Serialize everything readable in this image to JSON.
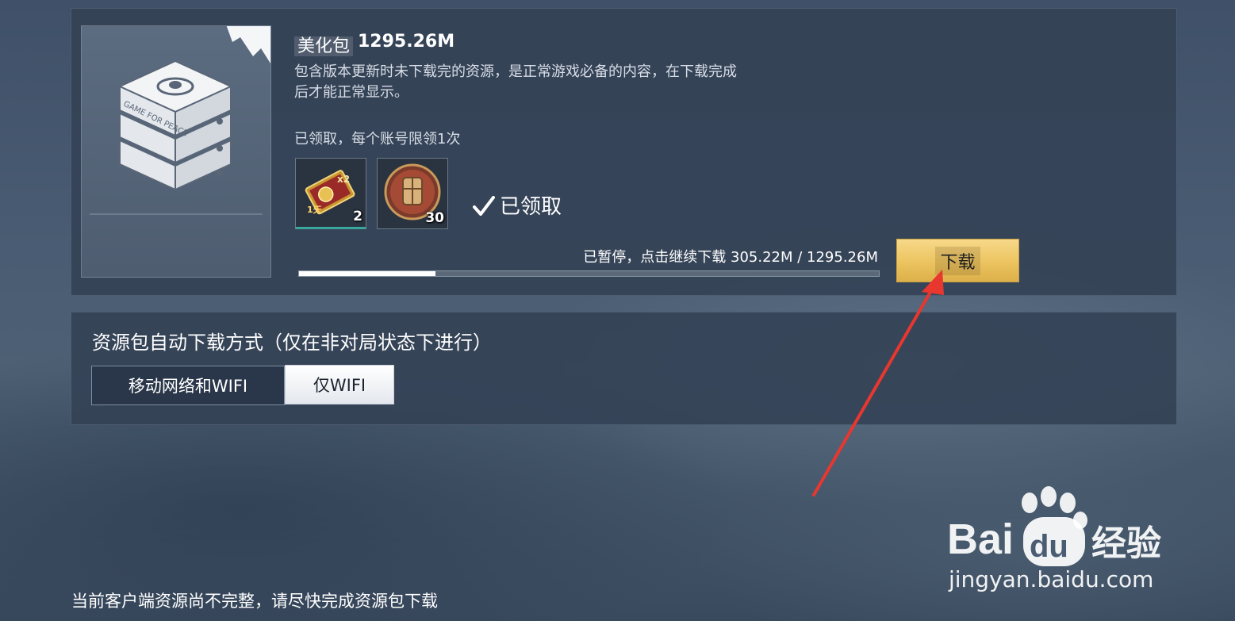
{
  "pack": {
    "name": "美化包",
    "size": "1295.26M",
    "description_line1": "包含版本更新时未下载完的资源，是正常游戏必备的内容，在下载完成",
    "description_line2": "后才能正常显示。",
    "claim_note": "已领取，每个账号限领1次",
    "thumb_label": "GAME FOR PEACE",
    "rewards": [
      {
        "name": "double-card-icon",
        "count": "2",
        "badge": "1天",
        "multiplier": "x2"
      },
      {
        "name": "supply-crate-icon",
        "count": "30"
      }
    ],
    "claimed_status": "已领取",
    "progress_text": "已暂停，点击继续下载 305.22M / 1295.26M",
    "progress_fraction": 0.2356,
    "download_label": "下载"
  },
  "auto_download": {
    "title": "资源包自动下载方式（仅在非对局状态下进行）",
    "options": [
      {
        "label": "移动网络和WIFI",
        "selected": false
      },
      {
        "label": "仅WIFI",
        "selected": true
      }
    ]
  },
  "footer_note": "当前客户端资源尚不完整，请尽快完成资源包下载",
  "watermark": {
    "brand": "Bai",
    "brand_du": "du",
    "brand_cn": "经验",
    "url": "jingyan.baidu.com"
  },
  "colors": {
    "accent_gold": "#ecc35f",
    "annotation_red": "#e8372f",
    "panel_bg": "#344256"
  }
}
